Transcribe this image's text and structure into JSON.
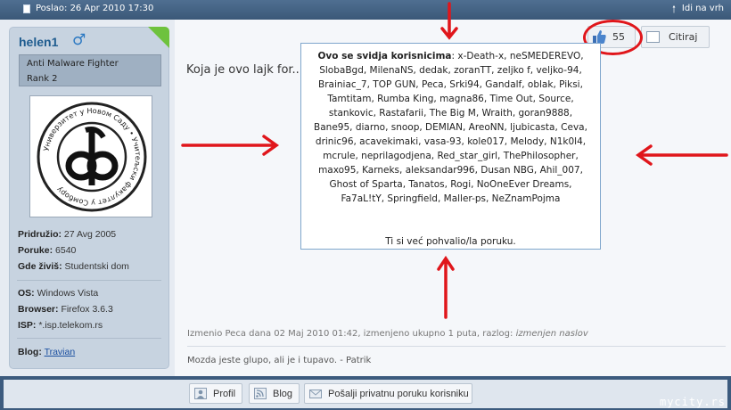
{
  "topbar": {
    "posted": "Poslao: 26 Apr 2010 17:30",
    "top_link": "Idi na vrh"
  },
  "user": {
    "name": "helen1",
    "rank_title": "Anti Malware Fighter",
    "rank": "Rank 2",
    "joined_label": "Pridružio:",
    "joined": "27 Avg 2005",
    "posts_label": "Poruke:",
    "posts": "6540",
    "location_label": "Gde živiš:",
    "location": "Studentski dom",
    "os_label": "OS:",
    "os": "Windows Vista",
    "browser_label": "Browser:",
    "browser": "Firefox 3.6.3",
    "isp_label": "ISP:",
    "isp": "*.isp.telekom.rs",
    "blog_label": "Blog:",
    "blog": "Travian",
    "avatar_ring_text": "Универзитет у Новом Саду • Учитељски факултет у Сомбору"
  },
  "post": {
    "text": "Koja je ovo lajk for...",
    "like_count": "55",
    "quote_label": "Citiraj",
    "popup_title": "Ovo se svidja korisnicima",
    "popup_users": ": x-Death-x, neSMEDEREVO, SlobaBgd, MilenaNS, dedak, zoranTT, zeljko f, veljko-94, Brainiac_7, TOP GUN, Peca, Srki94, Gandalf, oblak, Piksi, Tamtitam, Rumba King, magna86, Time Out, Source, stankovic, Rastafarii, The Big M, Wraith, goran9888, Bane95, diarno, snoop, DEMIAN, AreoNN, ljubicasta, Ceva, drinic96, acavekimaki, vasa-93, kole017, Melody, N1k0l4, mcrule, neprilagodjena, Red_star_girl, ThePhilosopher, maxo95, Karneks, aleksandar996, Dusan NBG, Ahil_007, Ghost of Sparta, Tanatos, Rogi, NoOneEver Dreams, Fa7aL!tY, Springfield, Maller-ps, NeZnamPojma",
    "popup_note": "Ti si već pohvalio/la poruku.",
    "edited_text": "Izmenio Peca dana 02 Maj 2010 01:42, izmenjeno ukupno 1 puta, razlog:",
    "edited_reason": "izmenjen naslov",
    "signature": "Mozda jeste glupo, ali je i tupavo. - Patrik"
  },
  "footer": {
    "profile": "Profil",
    "blog": "Blog",
    "pm": "Pošalji privatnu poruku korisniku",
    "watermark": "mycity.rs"
  },
  "colors": {
    "annotation_red": "#e0161b",
    "header_blue": "#3b5878",
    "username_blue": "#1f5c8f",
    "online_green": "#6ec23d"
  }
}
